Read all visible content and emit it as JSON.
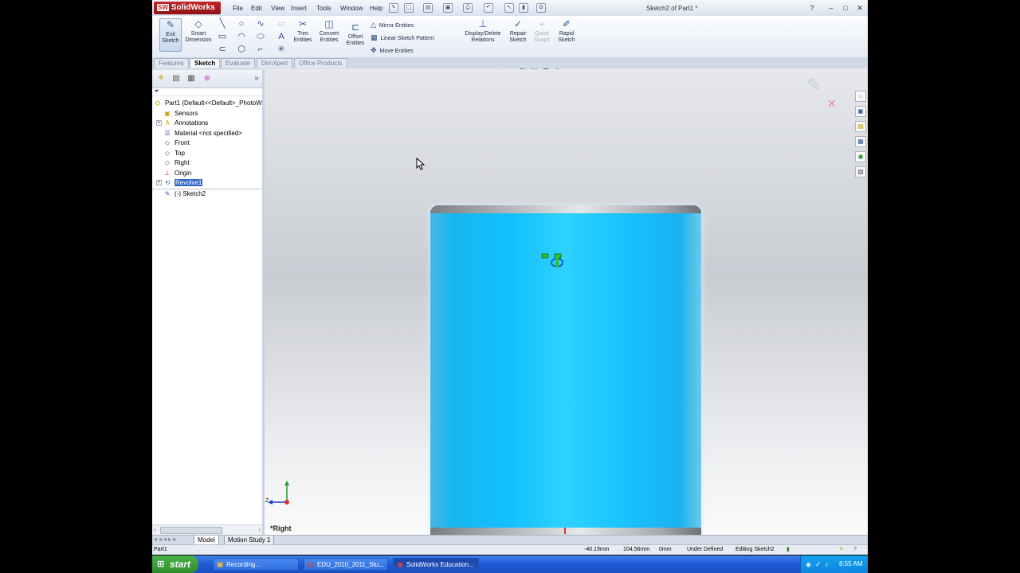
{
  "app": {
    "logo_text": "SolidWorks",
    "document_title": "Sketch2 of Part1 *"
  },
  "menu": [
    "File",
    "Edit",
    "View",
    "Insert",
    "Tools",
    "Window",
    "Help"
  ],
  "ribbon": {
    "exit_sketch": "Exit Sketch",
    "smart_dimension": "Smart Dimension",
    "trim_entities": "Trim Entities",
    "convert_entities": "Convert Entities",
    "offset_entities": "Offset Entities",
    "mirror_entities": "Mirror Entities",
    "linear_sketch_pattern": "Linear Sketch Pattern",
    "move_entities": "Move Entities",
    "display_delete_relations": "Display/Delete Relations",
    "repair_sketch": "Repair Sketch",
    "quick_snaps": "Quick Snaps",
    "rapid_sketch": "Rapid Sketch"
  },
  "command_tabs": [
    "Features",
    "Sketch",
    "Evaluate",
    "DimXpert",
    "Office Products"
  ],
  "active_command_tab": "Sketch",
  "feature_tree": {
    "root": "Part1  (Default<<Default>_PhotoW",
    "items": [
      {
        "label": "Sensors",
        "icon": "sensor-icon"
      },
      {
        "label": "Annotations",
        "icon": "annotations-icon"
      },
      {
        "label": "Material <not specified>",
        "icon": "material-icon"
      },
      {
        "label": "Front",
        "icon": "plane-icon"
      },
      {
        "label": "Top",
        "icon": "plane-icon"
      },
      {
        "label": "Right",
        "icon": "plane-icon"
      },
      {
        "label": "Origin",
        "icon": "origin-icon"
      },
      {
        "label": "Revolve1",
        "icon": "revolve-icon"
      },
      {
        "label": "(-) Sketch2",
        "icon": "sketch-icon"
      }
    ],
    "selected": "Revolve1"
  },
  "graphics": {
    "view_name": "*Right",
    "triad_axis": "Z"
  },
  "model_tabs": [
    "Model",
    "Motion Study 1"
  ],
  "active_model_tab": "Model",
  "status_bar": {
    "part": "Part1",
    "x": "-40.19mm",
    "y": "104.56mm",
    "z": "0mm",
    "definition": "Under Defined",
    "mode": "Editing Sketch2"
  },
  "taskbar": {
    "start": "start",
    "tasks": [
      "Recording...",
      "EDU_2010_2011_Stu...",
      "SolidWorks Education..."
    ],
    "active_task": "SolidWorks Education...",
    "clock": "8:55 AM"
  },
  "colors": {
    "part_body": "#13c0ff",
    "selection": "#3169c6",
    "taskbar": "#1e5ad6"
  }
}
